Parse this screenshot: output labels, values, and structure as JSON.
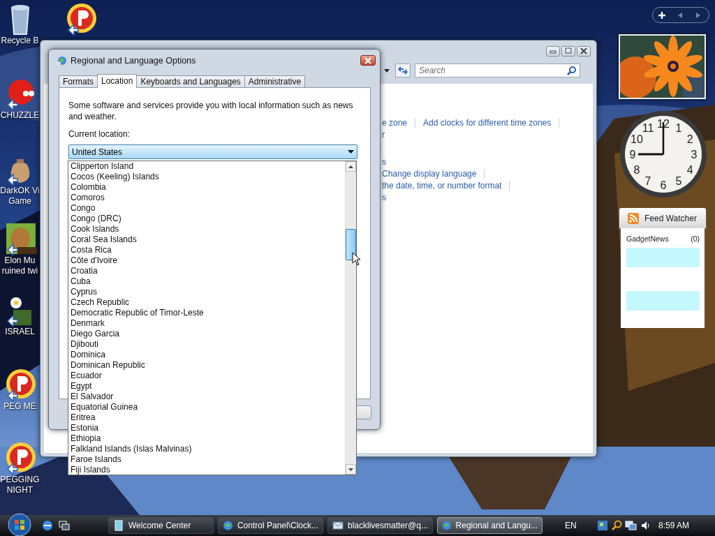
{
  "desktop": {
    "icons": [
      {
        "kind": "recycle",
        "lines": [
          "Recycle B"
        ]
      },
      {
        "kind": "peg"
      },
      {
        "kind": "chuzzle",
        "lines": [
          "CHUZZLE"
        ]
      },
      {
        "kind": "money",
        "lines": [
          "DarkOK Vi",
          "Game"
        ]
      },
      {
        "kind": "beaver",
        "lines": [
          "Elon Mu",
          "ruined twi"
        ]
      },
      {
        "kind": "flower",
        "lines": [
          "ISRAEL"
        ]
      },
      {
        "kind": "peg",
        "lines": [
          "PEG ME"
        ]
      },
      {
        "kind": "peg",
        "lines": [
          "PEGGING",
          "NIGHT"
        ]
      }
    ]
  },
  "control_panel": {
    "search": {
      "placeholder": "Search"
    },
    "sections": [
      {
        "rows": [
          [
            {
              "text": "e zone",
              "divider": true
            },
            {
              "text": "Add clocks for different time zones",
              "divider": true
            }
          ],
          [
            {
              "text": "r",
              "divider": false
            }
          ]
        ]
      },
      {
        "rows": [
          [
            {
              "text": "s",
              "divider": false
            }
          ],
          [
            {
              "text": "Change display language",
              "divider": true
            }
          ],
          [
            {
              "text": "the date, time, or number format",
              "divider": true
            }
          ],
          [
            {
              "text": "s",
              "divider": false
            }
          ]
        ]
      }
    ]
  },
  "dialog": {
    "title": "Regional and Language Options",
    "tabs": [
      {
        "label": "Formats",
        "selected": false
      },
      {
        "label": "Location",
        "selected": true
      },
      {
        "label": "Keyboards and Languages",
        "selected": false
      },
      {
        "label": "Administrative",
        "selected": false
      }
    ],
    "description": "Some software and services provide you with local information such as news and weather.",
    "location_label": "Current location:",
    "location": {
      "value": "United States",
      "expanded": true
    },
    "options": [
      "Clipperton Island",
      "Cocos (Keeling) Islands",
      "Colombia",
      "Comoros",
      "Congo",
      "Congo (DRC)",
      "Cook Islands",
      "Coral Sea Islands",
      "Costa Rica",
      "Côte d'Ivoire",
      "Croatia",
      "Cuba",
      "Cyprus",
      "Czech Republic",
      "Democratic Republic of Timor-Leste",
      "Denmark",
      "Diego Garcia",
      "Djibouti",
      "Dominica",
      "Dominican Republic",
      "Ecuador",
      "Egypt",
      "El Salvador",
      "Equatorial Guinea",
      "Eritrea",
      "Estonia",
      "Ethiopia",
      "Falkland Islands (Islas Malvinas)",
      "Faroe Islands",
      "Fiji Islands"
    ]
  },
  "gadgets": {
    "clock": {
      "numerals": [
        "12",
        "11",
        "1",
        "10",
        "2",
        "9",
        "3",
        "8",
        "4",
        "7",
        "5",
        "6"
      ]
    },
    "feed": {
      "title": "Feed Watcher",
      "feed_name": "GadgetNews",
      "count": "(0)"
    }
  },
  "taskbar": {
    "tasks": [
      {
        "label": "Welcome Center",
        "kind": "document",
        "selected": false
      },
      {
        "label": "Control Panel\\Clock...",
        "kind": "globe",
        "selected": false
      },
      {
        "label": "blacklivesmatter@q...",
        "kind": "mail",
        "selected": false
      },
      {
        "label": "Regional and Langu...",
        "kind": "globe",
        "selected": true
      }
    ],
    "language": "EN",
    "time": "8:59 AM"
  }
}
